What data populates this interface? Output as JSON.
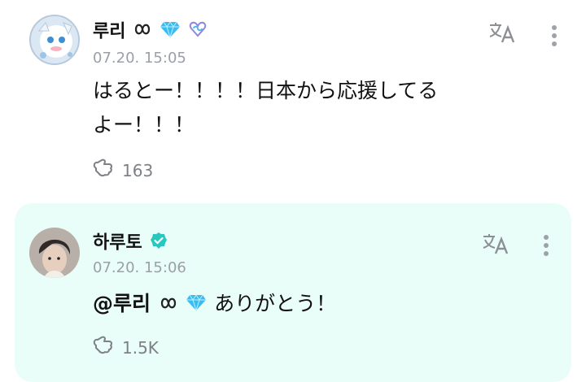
{
  "post": {
    "author": "루리",
    "timestamp": "07.20. 15:05",
    "lines": [
      "はるとー！！！！日本から応援してる",
      "よー！！！"
    ],
    "reactions": "163",
    "icons": {
      "reaction": "reaction-icon",
      "translate": "translate-icon",
      "more": "more-icon"
    }
  },
  "reply": {
    "author": "하루토",
    "timestamp": "07.20. 15:06",
    "mention": "@루리",
    "text": " ありがとう！",
    "reactions": "1.5K",
    "icons": {
      "verified": "verified-badge-icon",
      "reaction": "reaction-icon",
      "translate": "translate-icon",
      "more": "more-icon"
    }
  },
  "colors": {
    "reply_bg": "#e9fdf9",
    "muted": "#9aa0a6",
    "gem": "#35b8ee",
    "verified": "#28c8c0"
  }
}
